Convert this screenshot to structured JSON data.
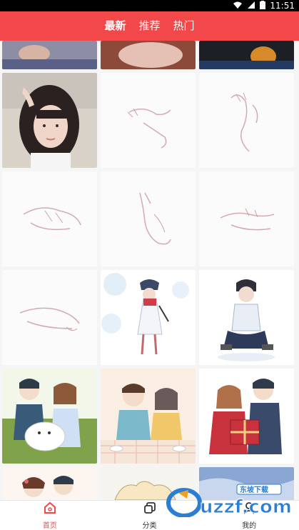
{
  "status_bar": {
    "time": "11:51",
    "icons": [
      "wifi-icon",
      "signal-icon",
      "battery-icon"
    ]
  },
  "header": {
    "tabs": [
      {
        "label": "最新",
        "active": true
      },
      {
        "label": "推荐",
        "active": false
      },
      {
        "label": "热门",
        "active": false
      }
    ],
    "color": "#f2484a"
  },
  "grid": {
    "items": [
      {
        "subject": "partial photo (top row)"
      },
      {
        "subject": "partial photo (top row)"
      },
      {
        "subject": "partial photo (top row)"
      },
      {
        "subject": "girl portrait photo"
      },
      {
        "subject": "hand sketch"
      },
      {
        "subject": "hand sketch"
      },
      {
        "subject": "hand sketch"
      },
      {
        "subject": "hand sketch"
      },
      {
        "subject": "hand sketch"
      },
      {
        "subject": "hand sketch"
      },
      {
        "subject": "girl with umbrella illustration"
      },
      {
        "subject": "sitting boy illustration"
      },
      {
        "subject": "couple illustration"
      },
      {
        "subject": "couple illustration"
      },
      {
        "subject": "couple illustration"
      },
      {
        "subject": "couple illustration (partial)"
      },
      {
        "subject": "illustration (partial)"
      },
      {
        "subject": "illustration (partial)"
      }
    ]
  },
  "bottom_nav": {
    "items": [
      {
        "label": "首页",
        "icon": "home-icon",
        "active": true
      },
      {
        "label": "分类",
        "icon": "category-icon",
        "active": false
      },
      {
        "label": "我的",
        "icon": "profile-icon",
        "active": false
      }
    ]
  },
  "watermark": {
    "brand": "uzzf.com",
    "subtitle": "东坡下载"
  }
}
